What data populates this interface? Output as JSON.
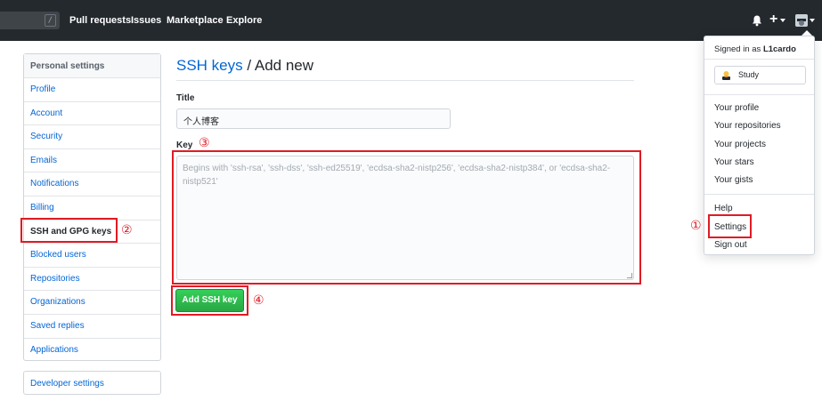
{
  "header": {
    "search_key": "/",
    "nav": [
      "Pull requests",
      "Issues",
      "Marketplace",
      "Explore"
    ],
    "plus_label": "+"
  },
  "sidebar": {
    "heading": "Personal settings",
    "items": [
      "Profile",
      "Account",
      "Security",
      "Emails",
      "Notifications",
      "Billing",
      "SSH and GPG keys",
      "Blocked users",
      "Repositories",
      "Organizations",
      "Saved replies",
      "Applications"
    ],
    "selected": "SSH and GPG keys",
    "developer": "Developer settings"
  },
  "main": {
    "breadcrumb_link": "SSH keys",
    "breadcrumb_rest": " / Add new",
    "title_label": "Title",
    "title_value": "个人博客",
    "key_label": "Key",
    "key_placeholder": "Begins with 'ssh-rsa', 'ssh-dss', 'ssh-ed25519', 'ecdsa-sha2-nistp256', 'ecdsa-sha2-nistp384', or 'ecdsa-sha2-nistp521'",
    "add_button": "Add SSH key"
  },
  "dropdown": {
    "signed_prefix": "Signed in as ",
    "username": "L1cardo",
    "status": "Study",
    "group1": [
      "Your profile",
      "Your repositories",
      "Your projects",
      "Your stars",
      "Your gists"
    ],
    "group2": [
      "Help",
      "Settings",
      "Sign out"
    ]
  },
  "annotations": [
    "①",
    "②",
    "③",
    "④"
  ],
  "colors": {
    "header_bg": "#24292e",
    "link": "#0366d6",
    "annotation_red": "#e01b24",
    "button_green": "#28a745"
  }
}
